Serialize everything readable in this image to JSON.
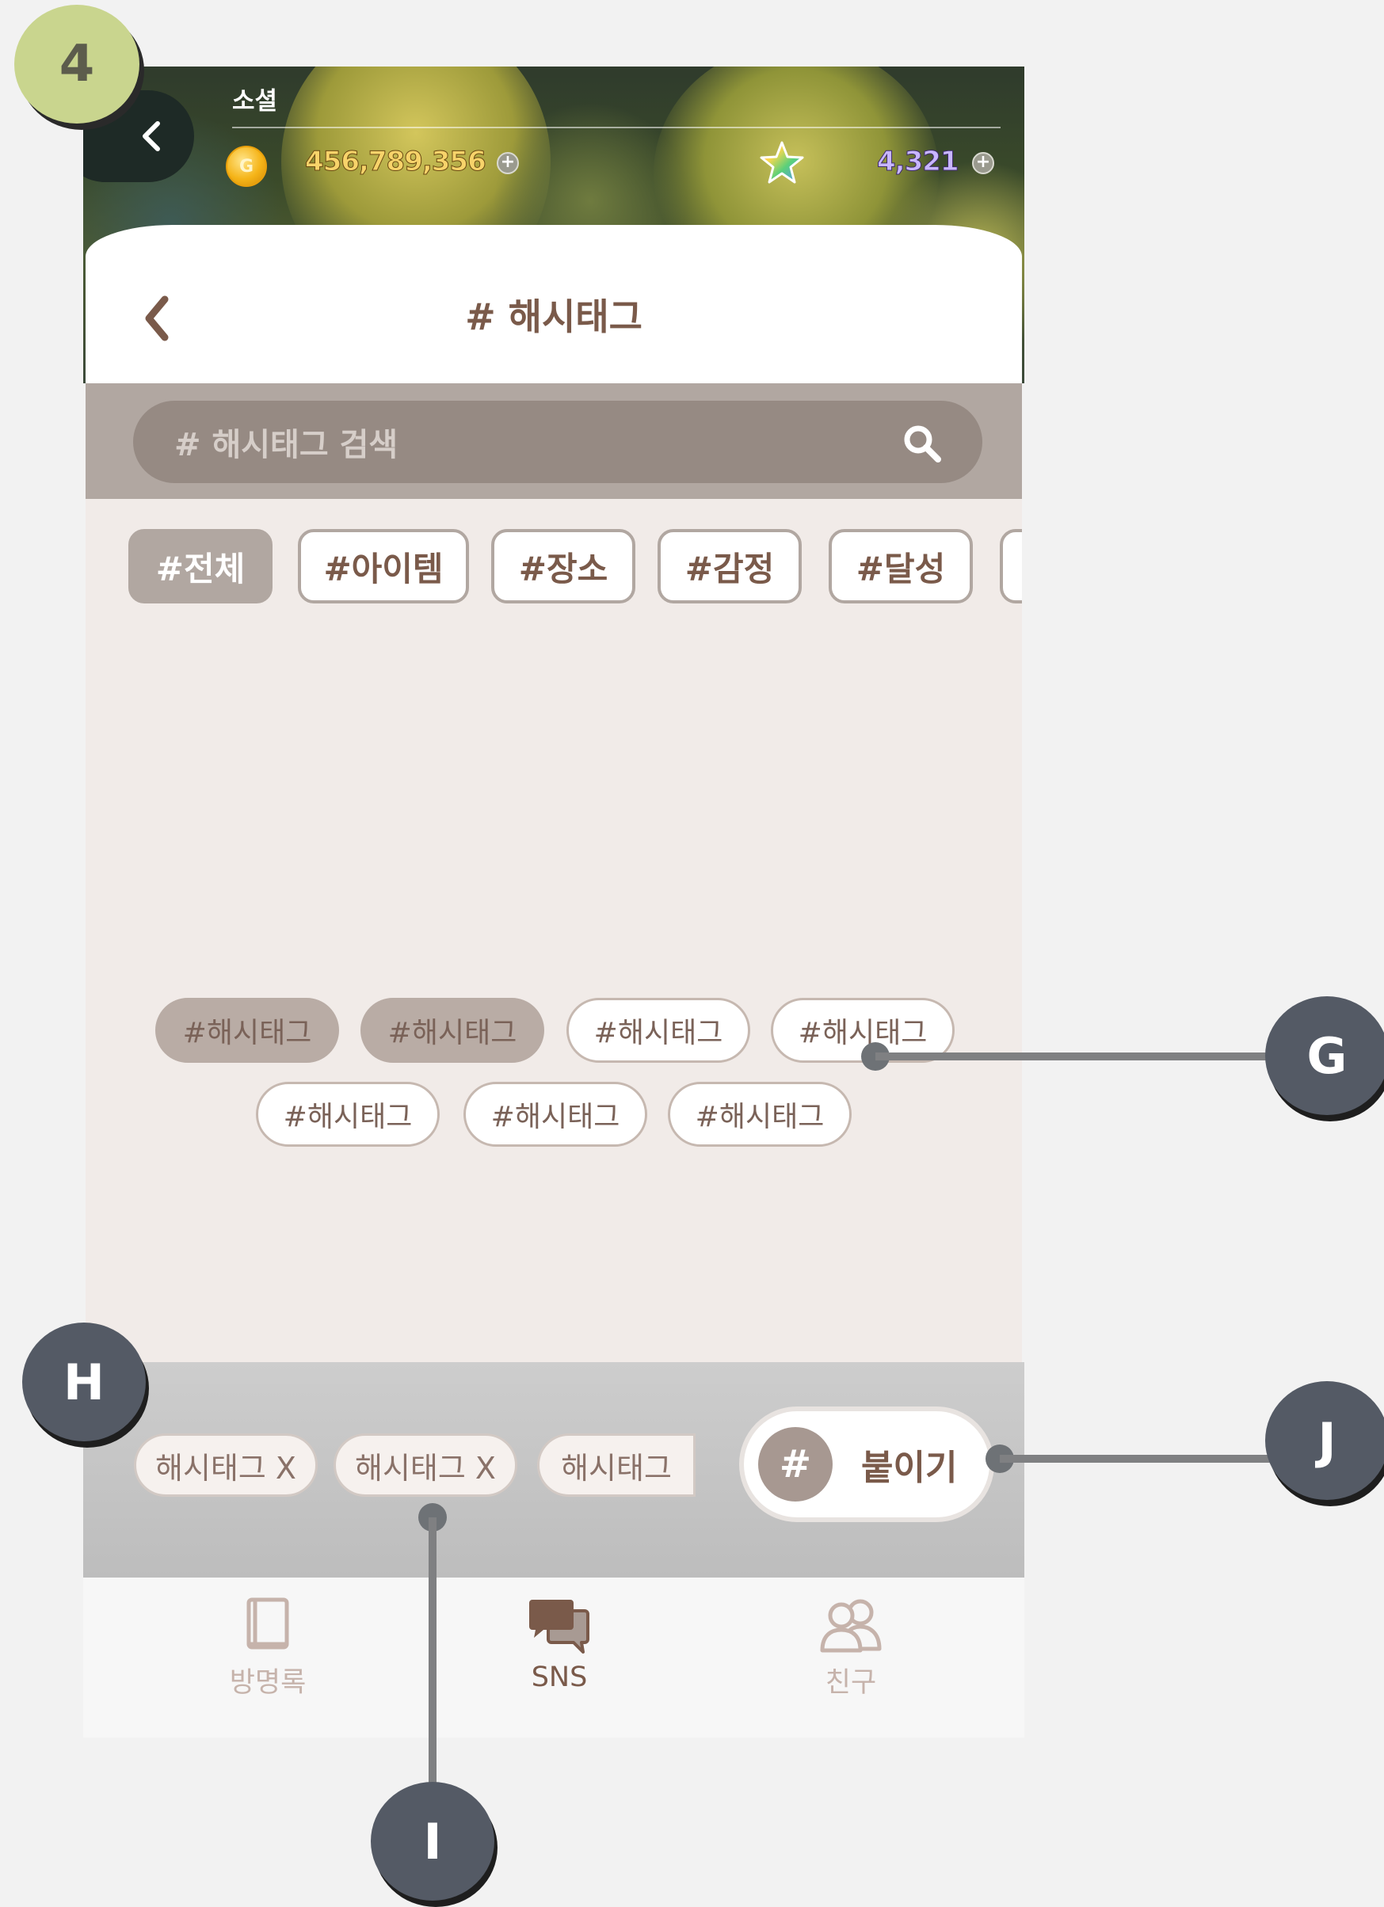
{
  "step_number": "4",
  "header": {
    "section_title": "소셜",
    "coins": "456,789,356",
    "stars": "4,321",
    "coin_icon_glyph": "G",
    "plus_glyph": "+"
  },
  "panel": {
    "title": "# 해시태그"
  },
  "search": {
    "placeholder": "# 해시태그 검색"
  },
  "categories": [
    "#전체",
    "#아이템",
    "#장소",
    "#감정",
    "#달성"
  ],
  "hashtags": [
    "#해시태그",
    "#해시태그",
    "#해시태그",
    "#해시태그",
    "#해시태그",
    "#해시태그",
    "#해시태그"
  ],
  "selected_chips": [
    "해시태그 X",
    "해시태그 X",
    "해시태그"
  ],
  "attach": {
    "hash": "#",
    "label": "붙이기"
  },
  "tabs": [
    {
      "label": "방명록",
      "icon": "book-icon"
    },
    {
      "label": "SNS",
      "icon": "chat-bubbles-icon"
    },
    {
      "label": "친구",
      "icon": "friends-icon"
    }
  ],
  "annotations": {
    "g": "G",
    "h": "H",
    "i": "I",
    "j": "J"
  },
  "colors": {
    "accent_brown": "#7a5a4a",
    "tag_border": "#b1a7a1",
    "content_bg": "#f1ebe8",
    "marker_bg": "#545a65",
    "step_badge": "#c9d58e"
  }
}
